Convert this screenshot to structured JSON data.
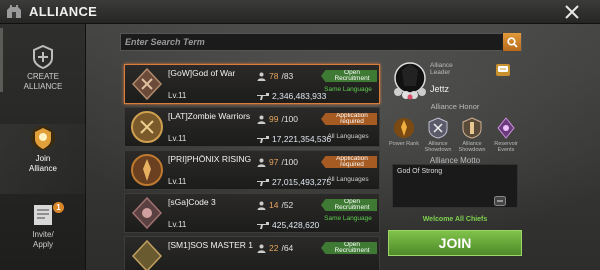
{
  "header": {
    "title": "ALLIANCE"
  },
  "sidebar": {
    "items": [
      {
        "label": "CREATE\nALLIANCE"
      },
      {
        "label": "Join\nAlliance"
      },
      {
        "label": "Invite/\nApply",
        "badge": "1"
      }
    ]
  },
  "search": {
    "placeholder": "Enter Search Term"
  },
  "alliances": [
    {
      "name": "[GoW]God of War",
      "level": "Lv.11",
      "members": "78",
      "max": "/83",
      "power": "2,346,483,933",
      "recruit": "Open Recruitment",
      "lang": "Same Language",
      "recruit_type": "open",
      "lang_type": "same"
    },
    {
      "name": "[LAT]Zombie Warriors",
      "level": "Lv.11",
      "members": "99",
      "max": "/100",
      "power": "17,221,354,536",
      "recruit": "Application required",
      "lang": "All Languages",
      "recruit_type": "app",
      "lang_type": "all"
    },
    {
      "name": "[PRI]PHÖNIX RISING",
      "level": "Lv.11",
      "members": "97",
      "max": "/100",
      "power": "27,015,493,275",
      "recruit": "Application required",
      "lang": "All Languages",
      "recruit_type": "app",
      "lang_type": "all"
    },
    {
      "name": "[sGa]Code 3",
      "level": "Lv.11",
      "members": "14",
      "max": "/52",
      "power": "425,428,620",
      "recruit": "Open Recruitment",
      "lang": "Same Language",
      "recruit_type": "open",
      "lang_type": "same"
    },
    {
      "name": "[SM1]SOS MASTER 1",
      "level": "",
      "members": "22",
      "max": "/64",
      "power": "",
      "recruit": "Open Recruitment",
      "lang": "",
      "recruit_type": "open",
      "lang_type": "same"
    }
  ],
  "detail": {
    "leader_label": "Alliance Leader",
    "leader_name": "Jettz",
    "honor_title": "Alliance Honor",
    "honors": [
      {
        "label": "Power Rank",
        "icon": "power-rank-icon"
      },
      {
        "label": "Alliance Showdown",
        "icon": "showdown-icon"
      },
      {
        "label": "Alliance Showdown",
        "icon": "showdown2-icon"
      },
      {
        "label": "Reservoir Events",
        "icon": "reservoir-icon"
      }
    ],
    "motto_title": "Alliance Motto",
    "motto": "God Of Strong",
    "welcome": "Welcome All Chiefs",
    "join": "JOIN"
  },
  "colors": {
    "accent": "#e29a3a",
    "open": "#3f7a34",
    "application": "#a55b22",
    "join": "#6aa83c",
    "same_language": "#5fcf4f"
  }
}
